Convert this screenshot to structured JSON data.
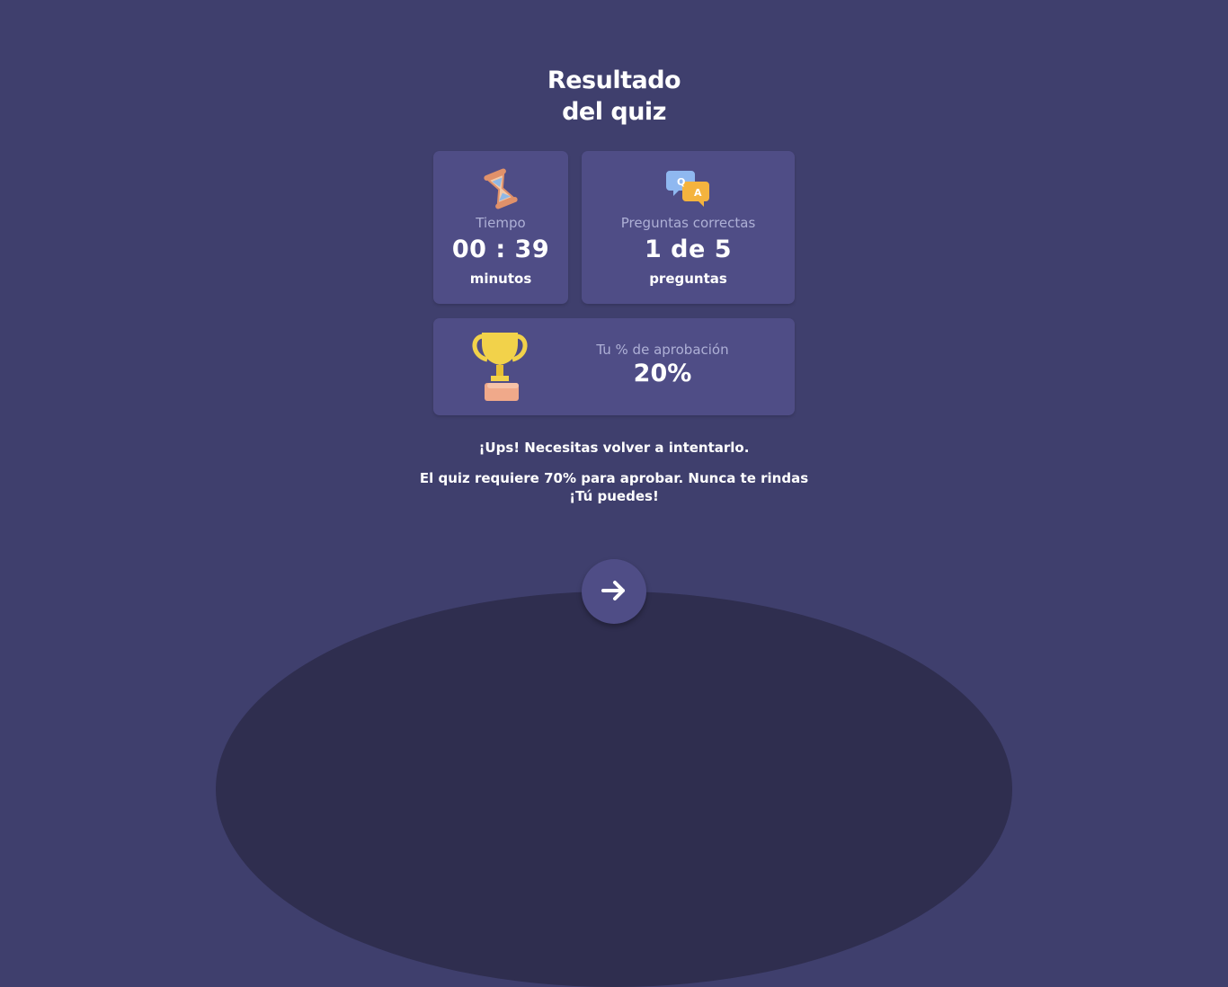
{
  "title": {
    "line1": "Resultado",
    "line2": "del quiz"
  },
  "time_card": {
    "icon": "hourglass-icon",
    "label": "Tiempo",
    "value": "00 : 39",
    "unit": "minutos"
  },
  "correct_card": {
    "icon": "chat-bubbles-icon",
    "label": "Preguntas correctas",
    "value": "1 de 5",
    "unit": "preguntas"
  },
  "score_card": {
    "icon": "trophy-icon",
    "label": "Tu % de aprobación",
    "value": "20%"
  },
  "message": {
    "headline": "¡Ups! Necesitas volver a intentarlo.",
    "line1": "El quiz requiere 70% para aprobar. Nunca te rindas",
    "line2": "¡Tú puedes!"
  },
  "next_button": {
    "icon": "arrow-right-icon"
  },
  "colors": {
    "background": "#3f3f6d",
    "card": "#4f4d86",
    "label": "#aeb0d6",
    "arc": "#2f2e4f"
  }
}
